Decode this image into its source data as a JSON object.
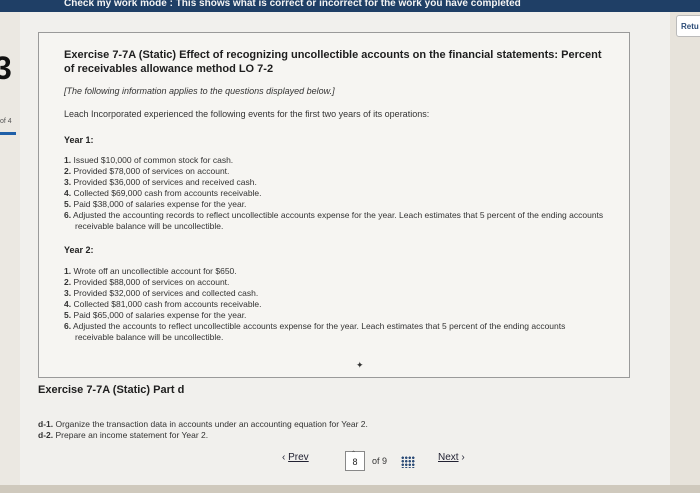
{
  "header": {
    "text": "Check my work mode : This shows what is correct or incorrect for the work you have completed"
  },
  "sidebar": {
    "progress_digit": "3",
    "progress_label": "of 4"
  },
  "return_button": {
    "label": "Retu"
  },
  "exercise": {
    "title": "Exercise 7-7A (Static) Effect of recognizing uncollectible accounts on the financial statements: Percent of receivables allowance method LO 7-2",
    "note": "[The following information applies to the questions displayed below.]",
    "intro": "Leach Incorporated experienced the following events for the first two years of its operations:",
    "year1": {
      "heading": "Year 1:",
      "items": [
        {
          "num": "1.",
          "text": "Issued $10,000 of common stock for cash."
        },
        {
          "num": "2.",
          "text": "Provided $78,000 of services on account."
        },
        {
          "num": "3.",
          "text": "Provided $36,000 of services and received cash."
        },
        {
          "num": "4.",
          "text": "Collected $69,000 cash from accounts receivable."
        },
        {
          "num": "5.",
          "text": "Paid $38,000 of salaries expense for the year."
        },
        {
          "num": "6.",
          "text": "Adjusted the accounting records to reflect uncollectible accounts expense for the year. Leach estimates that 5 percent of the ending accounts receivable balance will be uncollectible."
        }
      ]
    },
    "year2": {
      "heading": "Year 2:",
      "items": [
        {
          "num": "1.",
          "text": "Wrote off an uncollectible account for $650."
        },
        {
          "num": "2.",
          "text": "Provided $88,000 of services on account."
        },
        {
          "num": "3.",
          "text": "Provided $32,000 of services and collected cash."
        },
        {
          "num": "4.",
          "text": "Collected $81,000 cash from accounts receivable."
        },
        {
          "num": "5.",
          "text": "Paid $65,000 of salaries expense for the year."
        },
        {
          "num": "6.",
          "text": "Adjusted the accounts to reflect uncollectible accounts expense for the year. Leach estimates that 5 percent of the ending accounts receivable balance will be uncollectible."
        }
      ]
    }
  },
  "part": {
    "title": "Exercise 7-7A (Static) Part d",
    "requirements": [
      {
        "num": "d-1.",
        "text": "Organize the transaction data in accounts under an accounting equation for Year 2."
      },
      {
        "num": "d-2.",
        "text": "Prepare an income statement for Year 2."
      }
    ]
  },
  "pagination": {
    "prev_label": "Prev",
    "current_page": "8",
    "of_label": "of 9",
    "next_label": "Next"
  }
}
